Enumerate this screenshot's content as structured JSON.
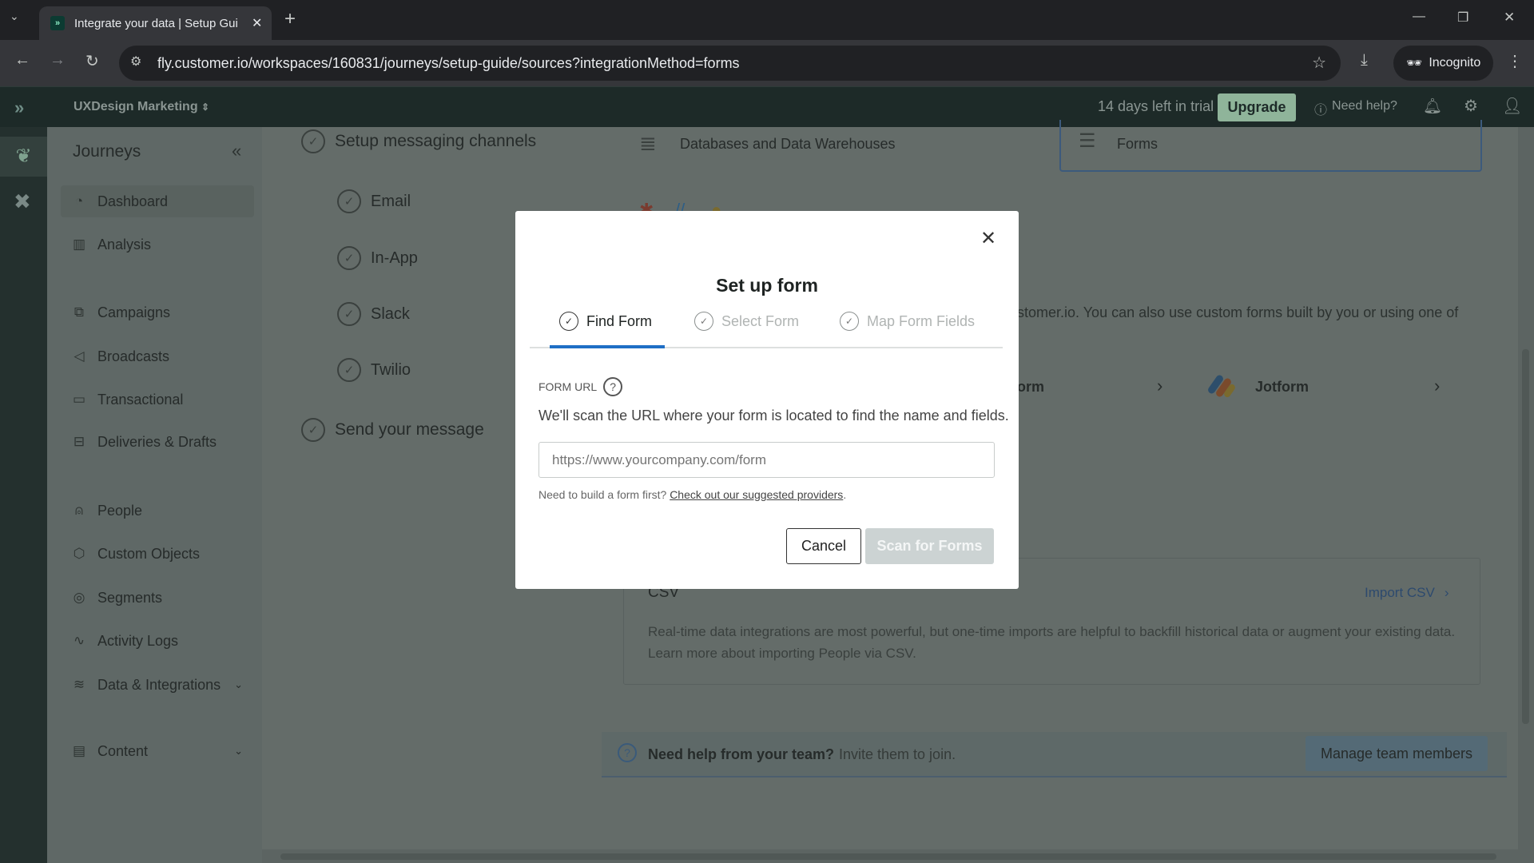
{
  "browser": {
    "tab_title": "Integrate your data | Setup Gui",
    "url": "fly.customer.io/workspaces/160831/journeys/setup-guide/sources?integrationMethod=forms",
    "incognito_label": "Incognito"
  },
  "header": {
    "workspace": "UXDesign Marketing",
    "trial": "14 days left in trial",
    "upgrade": "Upgrade",
    "help": "Need help?"
  },
  "sidebar": {
    "title": "Journeys",
    "items": [
      {
        "label": "Dashboard",
        "icon": "dashboard-icon"
      },
      {
        "label": "Analysis",
        "icon": "bar-chart-icon"
      },
      {
        "label": "Campaigns",
        "icon": "campaign-icon"
      },
      {
        "label": "Broadcasts",
        "icon": "megaphone-icon"
      },
      {
        "label": "Transactional",
        "icon": "mail-icon"
      },
      {
        "label": "Deliveries & Drafts",
        "icon": "inbox-icon"
      },
      {
        "label": "People",
        "icon": "person-icon"
      },
      {
        "label": "Custom Objects",
        "icon": "cube-icon"
      },
      {
        "label": "Segments",
        "icon": "segments-icon"
      },
      {
        "label": "Activity Logs",
        "icon": "activity-icon"
      },
      {
        "label": "Data & Integrations",
        "icon": "database-icon"
      },
      {
        "label": "Content",
        "icon": "content-icon"
      }
    ]
  },
  "steps": {
    "messaging": "Setup messaging channels",
    "channels": [
      "Email",
      "In-App",
      "Slack",
      "Twilio"
    ],
    "send": "Send your message"
  },
  "sources": {
    "databases": "Databases and Data Warehouses",
    "forms": "Forms",
    "intro_fragment": "stomer.io. You can also use custom forms built by you or using one of",
    "provider_fragment": "orm",
    "jotform": "Jotform"
  },
  "csv": {
    "title": "CSV",
    "import": "Import CSV",
    "description": "Real-time data integrations are most powerful, but one-time imports are helpful to backfill historical data or augment your existing data. Learn more about importing People via CSV."
  },
  "help_bar": {
    "bold": "Need help from your team?",
    "text": "Invite them to join.",
    "button": "Manage team members"
  },
  "modal": {
    "title": "Set up form",
    "tabs": [
      "Find Form",
      "Select Form",
      "Map Form Fields"
    ],
    "active_tab": 0,
    "field_label": "FORM URL",
    "description": "We'll scan the URL where your form is located to find the name and fields.",
    "placeholder": "https://www.yourcompany.com/form",
    "hint": "Need to build a form first?",
    "hint_link": "Check out our suggested providers",
    "cancel": "Cancel",
    "scan": "Scan for Forms"
  },
  "colors": {
    "accent": "#1f6fc5",
    "header": "#1d2a28",
    "upgrade": "#8fb49a"
  }
}
